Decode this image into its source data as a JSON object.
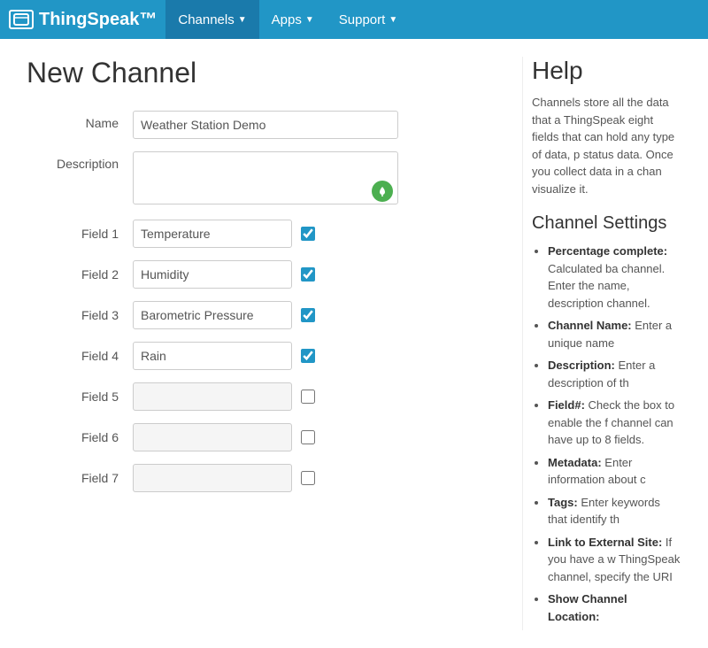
{
  "navbar": {
    "brand": "ThingSpeak™",
    "brand_icon": "□",
    "channels_label": "Channels",
    "apps_label": "Apps",
    "support_label": "Support"
  },
  "page": {
    "title": "New Channel"
  },
  "form": {
    "name_label": "Name",
    "name_value": "Weather Station Demo",
    "description_label": "Description",
    "description_placeholder": "",
    "description_icon": "G",
    "fields": [
      {
        "label": "Field 1",
        "value": "Temperature",
        "checked": true,
        "empty": false
      },
      {
        "label": "Field 2",
        "value": "Humidity",
        "checked": true,
        "empty": false
      },
      {
        "label": "Field 3",
        "value": "Barometric Pressure",
        "checked": true,
        "empty": false
      },
      {
        "label": "Field 4",
        "value": "Rain",
        "checked": true,
        "empty": false
      },
      {
        "label": "Field 5",
        "value": "",
        "checked": false,
        "empty": true
      },
      {
        "label": "Field 6",
        "value": "",
        "checked": false,
        "empty": true
      },
      {
        "label": "Field 7",
        "value": "",
        "checked": false,
        "empty": true
      }
    ]
  },
  "help": {
    "title": "Help",
    "intro": "Channels store all the data that a ThingSpeak eight fields that can hold any type of data, p status data. Once you collect data in a chan visualize it.",
    "section_title": "Channel Settings",
    "items": [
      {
        "bold": "Percentage complete:",
        "text": " Calculated ba channel. Enter the name, description channel."
      },
      {
        "bold": "Channel Name:",
        "text": " Enter a unique name"
      },
      {
        "bold": "Description:",
        "text": " Enter a description of th"
      },
      {
        "bold": "Field#:",
        "text": " Check the box to enable the f channel can have up to 8 fields."
      },
      {
        "bold": "Metadata:",
        "text": " Enter information about c"
      },
      {
        "bold": "Tags:",
        "text": " Enter keywords that identify th"
      },
      {
        "bold": "Link to External Site:",
        "text": " If you have a w ThingSpeak channel, specify the URI"
      },
      {
        "bold": "Show Channel Location:",
        "text": ""
      }
    ]
  }
}
